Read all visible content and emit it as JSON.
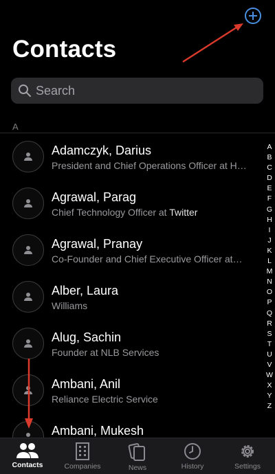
{
  "header": {
    "title": "Contacts"
  },
  "search": {
    "placeholder": "Search"
  },
  "section": {
    "letter": "A"
  },
  "contacts": [
    {
      "name": "Adamczyk, Darius",
      "subtitle": "President and Chief Operations Officer at H…",
      "company": ""
    },
    {
      "name": "Agrawal, Parag",
      "subtitle": "Chief Technology Officer at ",
      "company": "Twitter"
    },
    {
      "name": "Agrawal, Pranay",
      "subtitle": "Co-Founder and Chief Executive Officer at…",
      "company": ""
    },
    {
      "name": "Alber, Laura",
      "subtitle": "Williams",
      "company": ""
    },
    {
      "name": "Alug, Sachin",
      "subtitle": "Founder at NLB Services",
      "company": ""
    },
    {
      "name": "Ambani, Anil",
      "subtitle": "Reliance Electric Service",
      "company": ""
    },
    {
      "name": "Ambani, Mukesh",
      "subtitle": "",
      "company": ""
    }
  ],
  "index_letters": [
    "A",
    "B",
    "C",
    "D",
    "E",
    "F",
    "G",
    "H",
    "I",
    "J",
    "K",
    "L",
    "M",
    "N",
    "O",
    "P",
    "Q",
    "R",
    "S",
    "T",
    "U",
    "V",
    "W",
    "X",
    "Y",
    "Z"
  ],
  "tabs": [
    {
      "label": "Contacts",
      "icon": "people-icon",
      "active": true
    },
    {
      "label": "Companies",
      "icon": "building-icon",
      "active": false
    },
    {
      "label": "News",
      "icon": "news-icon",
      "active": false
    },
    {
      "label": "History",
      "icon": "clock-icon",
      "active": false
    },
    {
      "label": "Settings",
      "icon": "gear-icon",
      "active": false
    }
  ],
  "colors": {
    "accent": "#4a90e2",
    "annotation_arrow": "#d93a2b"
  }
}
